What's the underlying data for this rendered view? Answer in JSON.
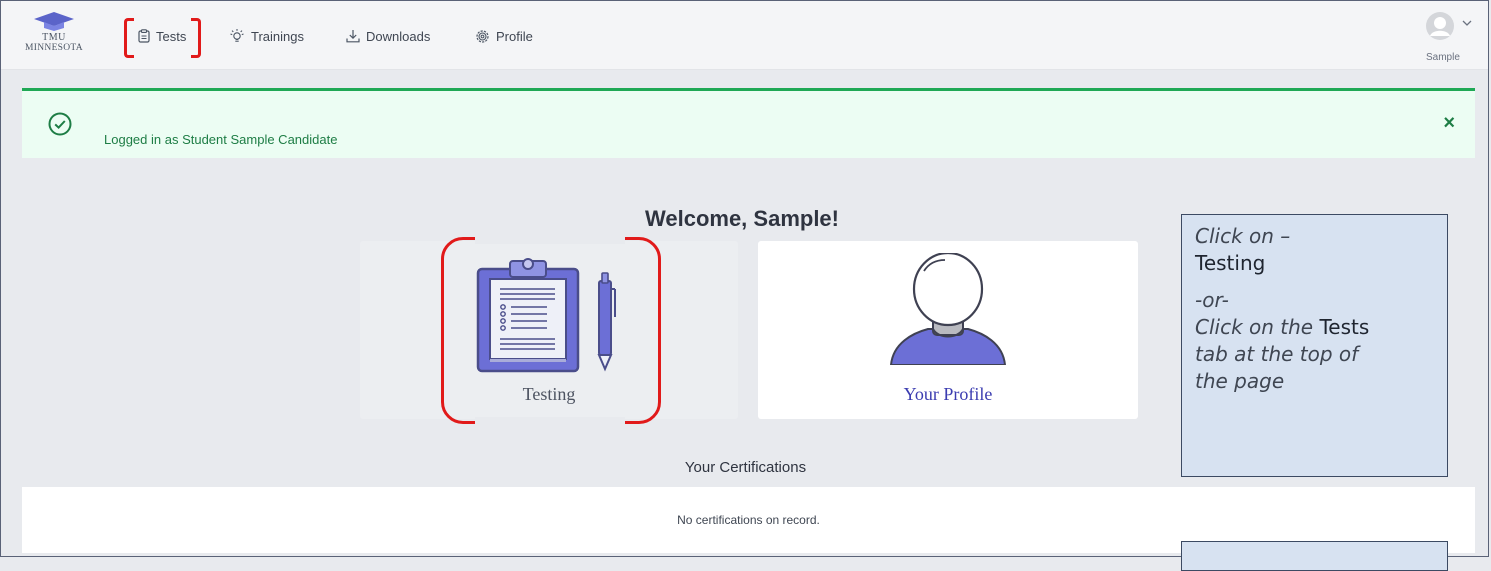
{
  "header": {
    "logo_line1": "TMU",
    "logo_line2": "MINNESOTA",
    "nav": [
      {
        "label": "Tests",
        "icon": "clipboard-icon"
      },
      {
        "label": "Trainings",
        "icon": "lightbulb-icon"
      },
      {
        "label": "Downloads",
        "icon": "download-icon"
      },
      {
        "label": "Profile",
        "icon": "gear-icon"
      }
    ],
    "user_name": "Sample"
  },
  "alert": {
    "message": "Logged in as Student Sample Candidate",
    "close_symbol": "×"
  },
  "main": {
    "welcome": "Welcome, Sample!",
    "cards": [
      {
        "label": "Testing",
        "icon": "clipboard-illustration"
      },
      {
        "label": "Your Profile",
        "icon": "person-illustration"
      }
    ],
    "certifications_title": "Your Certifications",
    "certifications_empty": "No certifications on record."
  },
  "callout": {
    "line1": "Click on –",
    "line2": "Testing",
    "line3": "-or-",
    "line4_prefix": "Click on the ",
    "line4_bold": "Tests",
    "line5": "tab at the top of",
    "line6": "the page"
  },
  "colors": {
    "accent_purple": "#6c6fd6",
    "success_green": "#1fa855",
    "highlight_red": "#e11a1a",
    "callout_bg": "#d7e2f1"
  }
}
